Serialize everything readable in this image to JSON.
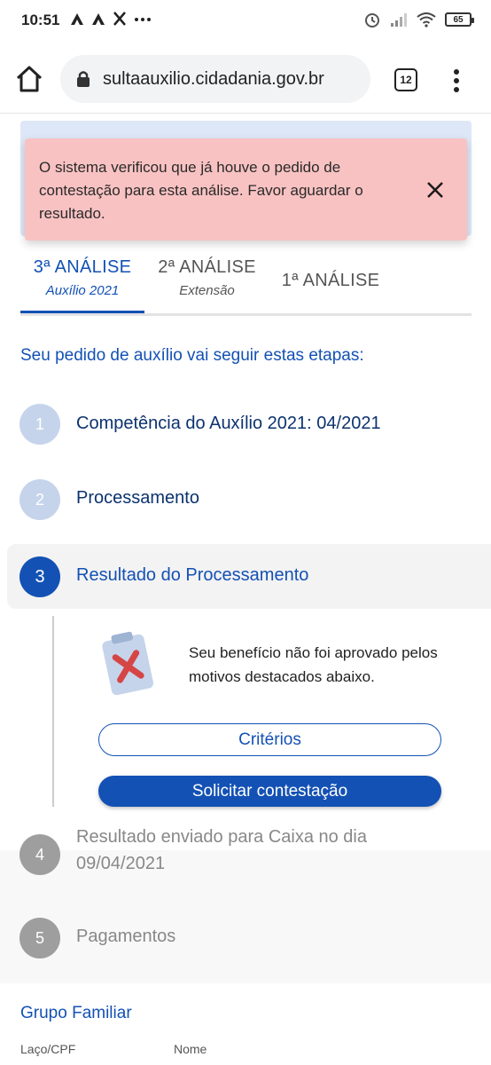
{
  "status_bar": {
    "time": "10:51",
    "left_icons": [
      "app-a-icon",
      "app-a-icon",
      "utensils-icon",
      "more-icon"
    ],
    "right_icons": [
      "alarm-icon",
      "signal-icon",
      "wifi-icon"
    ],
    "battery": "65"
  },
  "browser": {
    "url": "sultaauxilio.cidadania.gov.br",
    "tab_count": "12"
  },
  "alert": {
    "message": "O sistema verificou que já houve o pedido de contestação para esta análise. Favor aguardar o resultado.",
    "background": "#f9c2c2"
  },
  "tabs": [
    {
      "title": "3ª ANÁLISE",
      "subtitle": "Auxílio 2021",
      "active": true
    },
    {
      "title": "2ª ANÁLISE",
      "subtitle": "Extensão",
      "active": false
    },
    {
      "title": "1ª ANÁLISE",
      "subtitle": "",
      "active": false
    }
  ],
  "steps_heading": "Seu pedido de auxílio vai seguir estas etapas:",
  "steps": [
    {
      "number": "1",
      "label": "Competência do Auxílio 2021: 04/2021",
      "state": "done"
    },
    {
      "number": "2",
      "label": "Processamento",
      "state": "done"
    },
    {
      "number": "3",
      "label": "Resultado do Processamento",
      "state": "current"
    },
    {
      "number": "4",
      "label_line1": "Resultado enviado para Caixa no dia",
      "label_line2": "09/04/2021",
      "state": "pending"
    },
    {
      "number": "5",
      "label": "Pagamentos",
      "state": "pending"
    }
  ],
  "result": {
    "icon": "rejected-clipboard-icon",
    "message": "Seu benefício não foi aprovado pelos motivos destacados abaixo."
  },
  "buttons": {
    "criteria": "Critérios",
    "contest": "Solicitar contestação"
  },
  "family_group": {
    "title": "Grupo Familiar",
    "columns": [
      "Laço/CPF",
      "Nome"
    ]
  },
  "colors": {
    "primary": "#1351b4",
    "dark_blue": "#0c326f",
    "step_done": "#c5d4eb",
    "step_pending": "#9e9e9e"
  }
}
